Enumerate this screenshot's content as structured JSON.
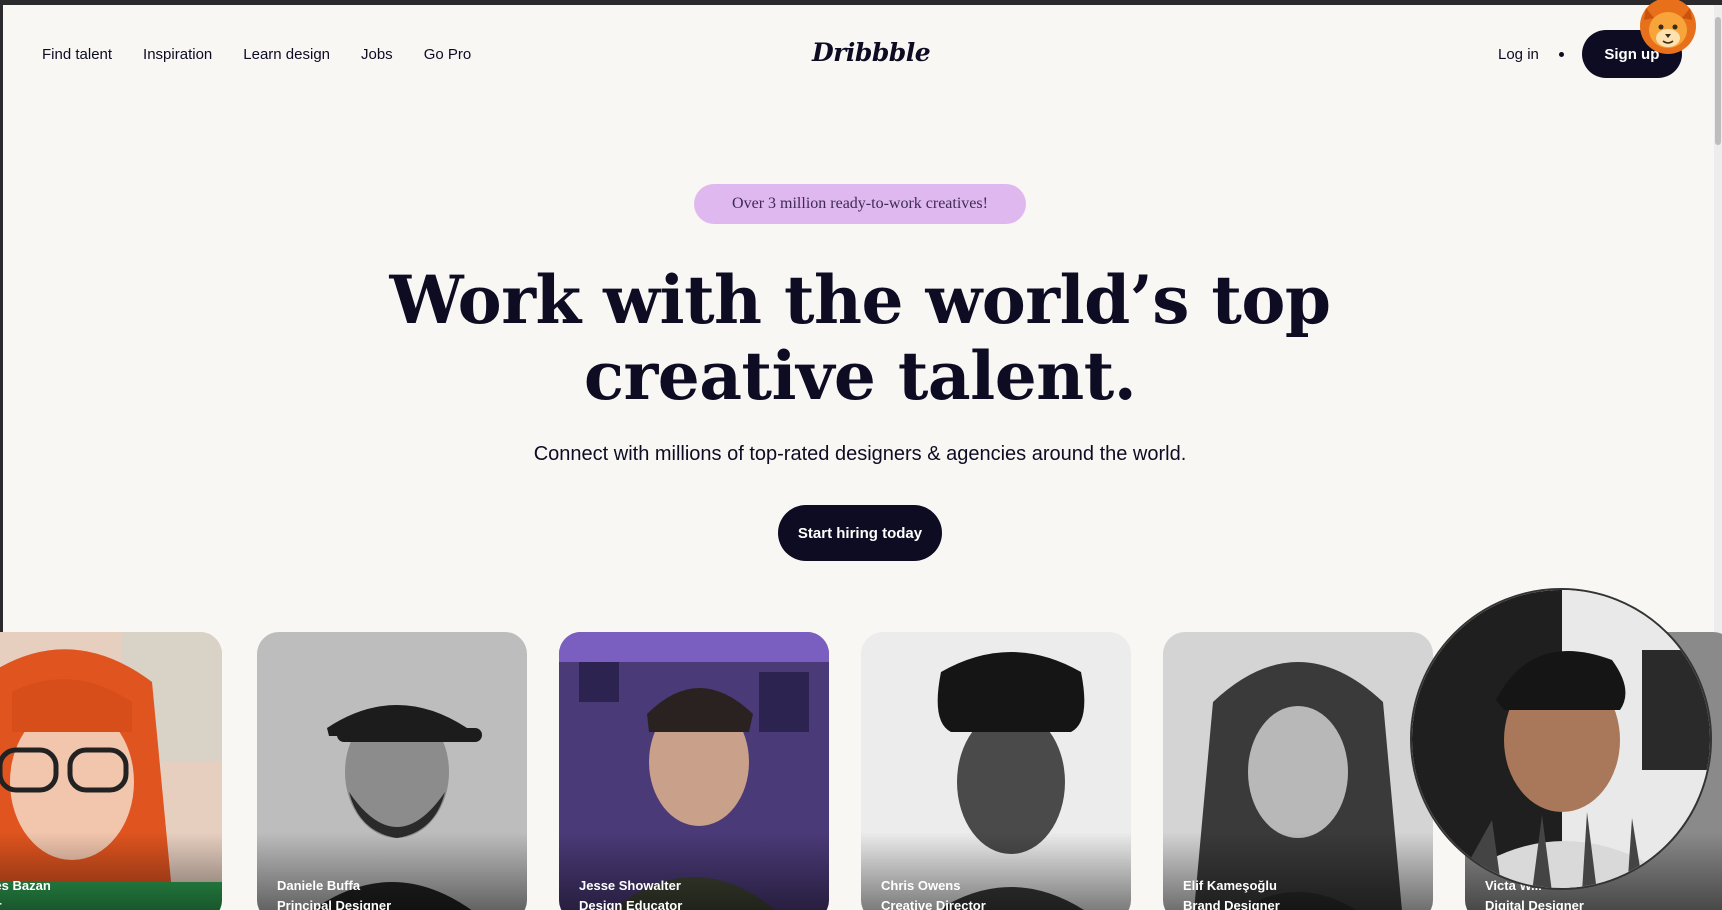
{
  "nav": {
    "links": [
      "Find talent",
      "Inspiration",
      "Learn design",
      "Jobs",
      "Go Pro"
    ],
    "logo": "Dribbble",
    "login": "Log in",
    "signup": "Sign up"
  },
  "hero": {
    "pill": "Over 3 million ready-to-work creatives!",
    "headline_line1": "Work with the world’s top",
    "headline_line2": "creative talent.",
    "subhead": "Connect with millions of top-rated designers & agencies around the world.",
    "cta": "Start hiring today"
  },
  "cards": [
    {
      "name": "cedes Bazan",
      "role": "rator"
    },
    {
      "name": "Daniele Buffa",
      "role": "Principal Designer"
    },
    {
      "name": "Jesse Showalter",
      "role": "Design Educator"
    },
    {
      "name": "Chris Owens",
      "role": "Creative Director"
    },
    {
      "name": "Elif Kameşoğlu",
      "role": "Brand Designer"
    },
    {
      "name": "Victa W...",
      "role": "Digital Designer"
    }
  ],
  "colors": {
    "background": "#f8f7f4",
    "ink": "#0d0c22",
    "pill": "#e0b8f0"
  },
  "icons": {
    "extension": "lion-icon"
  }
}
